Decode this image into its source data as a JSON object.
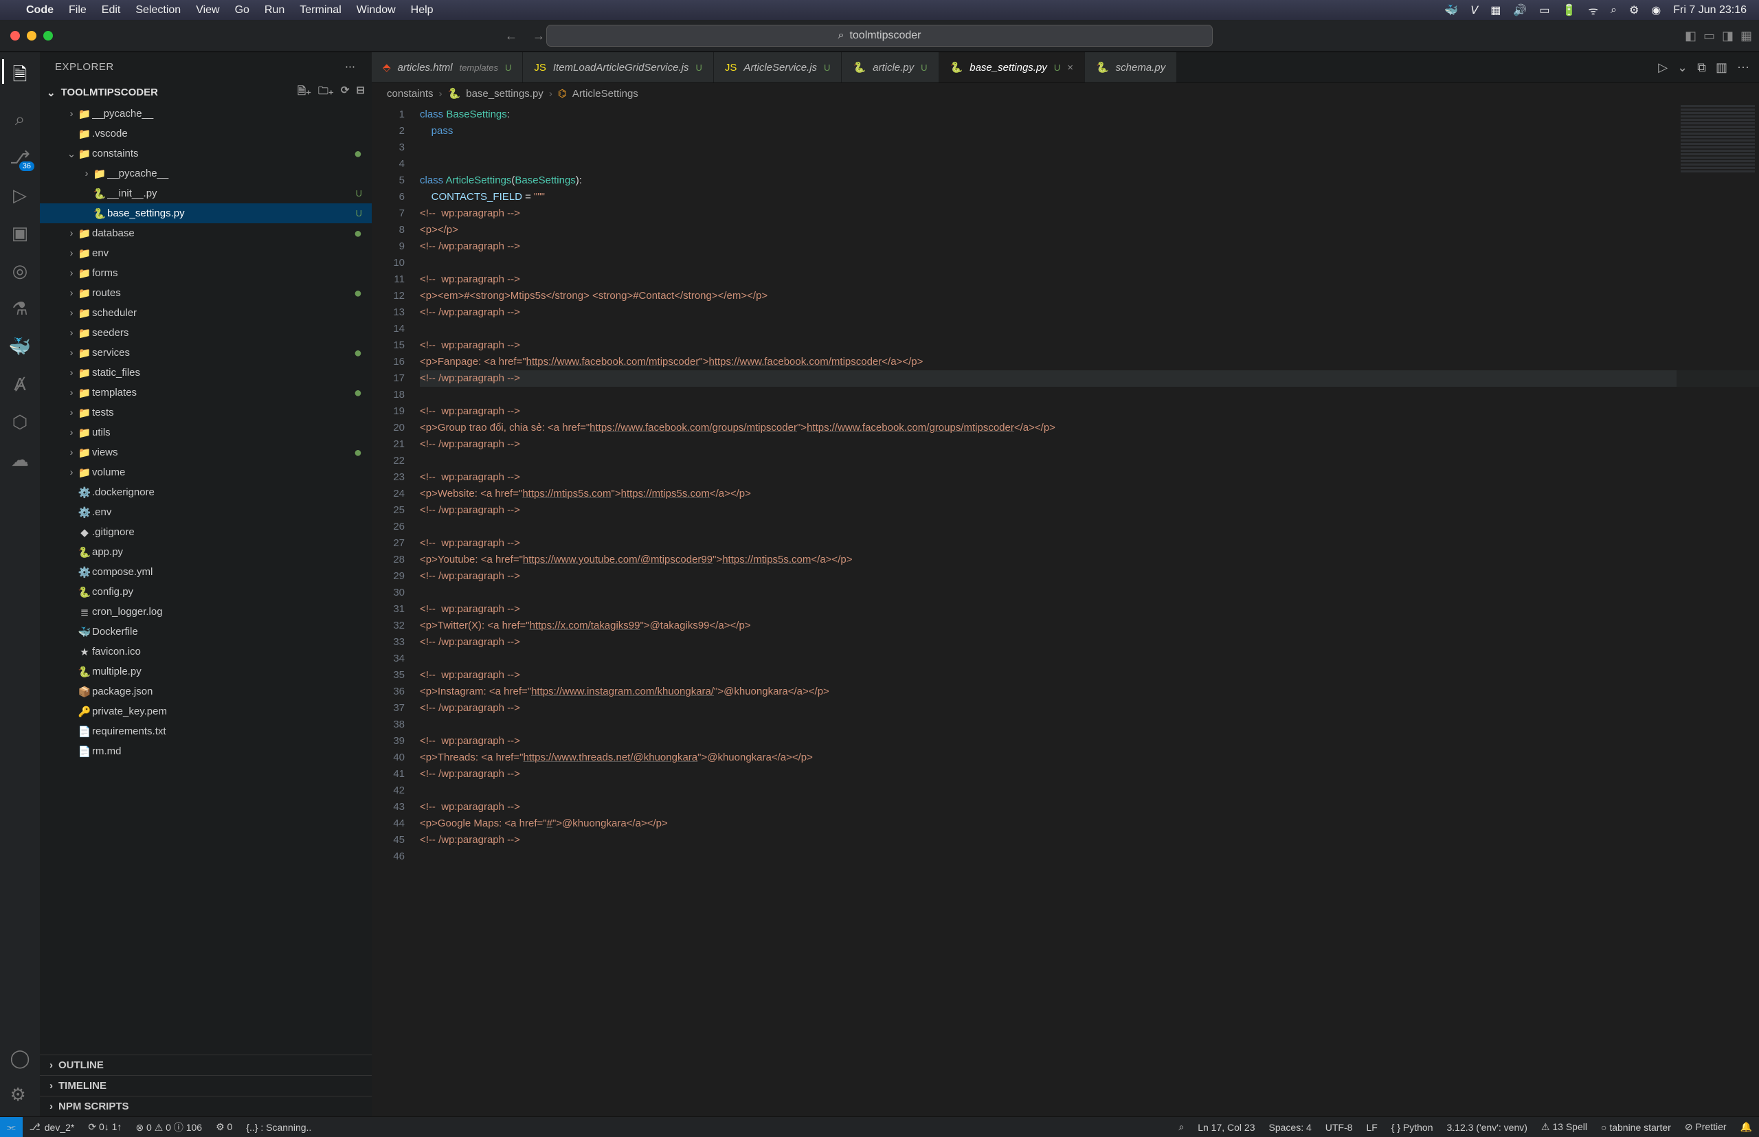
{
  "macos": {
    "app": "Code",
    "menus": [
      "File",
      "Edit",
      "Selection",
      "View",
      "Go",
      "Run",
      "Terminal",
      "Window",
      "Help"
    ],
    "clock": "Fri 7 Jun  23:16"
  },
  "window": {
    "search_placeholder": "toolmtipscoder"
  },
  "explorer": {
    "title": "EXPLORER",
    "root": "TOOLMTIPSCODER",
    "sections": {
      "outline": "OUTLINE",
      "timeline": "TIMELINE",
      "npm": "NPM SCRIPTS"
    }
  },
  "tree": [
    {
      "d": 1,
      "c": ">",
      "i": "📁",
      "n": "__pycache__",
      "cls": "folder",
      "badge": ""
    },
    {
      "d": 1,
      "c": "",
      "i": "📁",
      "n": ".vscode",
      "cls": "folder"
    },
    {
      "d": 1,
      "c": "v",
      "i": "📁",
      "n": "constaints",
      "cls": "folder",
      "dot": true
    },
    {
      "d": 2,
      "c": ">",
      "i": "📁",
      "n": "__pycache__",
      "cls": "folder"
    },
    {
      "d": 2,
      "c": "",
      "i": "🐍",
      "n": "__init__.py",
      "st": "U"
    },
    {
      "d": 2,
      "c": "",
      "i": "🐍",
      "n": "base_settings.py",
      "st": "U",
      "sel": true
    },
    {
      "d": 1,
      "c": ">",
      "i": "📁",
      "n": "database",
      "cls": "folder",
      "dot": true
    },
    {
      "d": 1,
      "c": ">",
      "i": "📁",
      "n": "env",
      "cls": "folder"
    },
    {
      "d": 1,
      "c": ">",
      "i": "📁",
      "n": "forms",
      "cls": "folder"
    },
    {
      "d": 1,
      "c": ">",
      "i": "📁",
      "n": "routes",
      "cls": "folder",
      "dot": true
    },
    {
      "d": 1,
      "c": ">",
      "i": "📁",
      "n": "scheduler",
      "cls": "folder"
    },
    {
      "d": 1,
      "c": ">",
      "i": "📁",
      "n": "seeders",
      "cls": "folder"
    },
    {
      "d": 1,
      "c": ">",
      "i": "📁",
      "n": "services",
      "cls": "folder",
      "dot": true
    },
    {
      "d": 1,
      "c": ">",
      "i": "📁",
      "n": "static_files",
      "cls": "folder"
    },
    {
      "d": 1,
      "c": ">",
      "i": "📁",
      "n": "templates",
      "cls": "folder",
      "dot": true
    },
    {
      "d": 1,
      "c": ">",
      "i": "📁",
      "n": "tests",
      "cls": "folder"
    },
    {
      "d": 1,
      "c": ">",
      "i": "📁",
      "n": "utils",
      "cls": "folder"
    },
    {
      "d": 1,
      "c": ">",
      "i": "📁",
      "n": "views",
      "cls": "folder",
      "dot": true
    },
    {
      "d": 1,
      "c": ">",
      "i": "📁",
      "n": "volume",
      "cls": "folder"
    },
    {
      "d": 1,
      "c": "",
      "i": "⚙️",
      "n": ".dockerignore"
    },
    {
      "d": 1,
      "c": "",
      "i": "⚙️",
      "n": ".env"
    },
    {
      "d": 1,
      "c": "",
      "i": "◆",
      "n": ".gitignore"
    },
    {
      "d": 1,
      "c": "",
      "i": "🐍",
      "n": "app.py"
    },
    {
      "d": 1,
      "c": "",
      "i": "⚙️",
      "n": "compose.yml"
    },
    {
      "d": 1,
      "c": "",
      "i": "🐍",
      "n": "config.py"
    },
    {
      "d": 1,
      "c": "",
      "i": "≣",
      "n": "cron_logger.log"
    },
    {
      "d": 1,
      "c": "",
      "i": "🐳",
      "n": "Dockerfile"
    },
    {
      "d": 1,
      "c": "",
      "i": "★",
      "n": "favicon.ico"
    },
    {
      "d": 1,
      "c": "",
      "i": "🐍",
      "n": "multiple.py"
    },
    {
      "d": 1,
      "c": "",
      "i": "📦",
      "n": "package.json"
    },
    {
      "d": 1,
      "c": "",
      "i": "🔑",
      "n": "private_key.pem"
    },
    {
      "d": 1,
      "c": "",
      "i": "📄",
      "n": "requirements.txt"
    },
    {
      "d": 1,
      "c": "",
      "i": "📄",
      "n": "rm.md"
    }
  ],
  "tabs": [
    {
      "i": "⬘",
      "fi": "#e44d26",
      "n": "articles.html",
      "sub": "templates",
      "st": "U"
    },
    {
      "i": "JS",
      "fi": "#f7df1e",
      "n": "ItemLoadArticleGridService.js",
      "st": "U"
    },
    {
      "i": "JS",
      "fi": "#f7df1e",
      "n": "ArticleService.js",
      "st": "U"
    },
    {
      "i": "🐍",
      "fi": "#4b8bbe",
      "n": "article.py",
      "st": "U"
    },
    {
      "i": "🐍",
      "fi": "#4b8bbe",
      "n": "base_settings.py",
      "st": "U",
      "active": true,
      "close": "×"
    },
    {
      "i": "🐍",
      "fi": "#4b8bbe",
      "n": "schema.py",
      "st": ""
    }
  ],
  "crumbs": [
    "constaints",
    "base_settings.py",
    "ArticleSettings"
  ],
  "code": [
    {
      "n": 1,
      "t": "class",
      "html": "<span class='k'>class</span> <span class='cls'>BaseSettings</span>:"
    },
    {
      "n": 2,
      "html": "    <span class='k'>pass</span>"
    },
    {
      "n": 3,
      "html": ""
    },
    {
      "n": 4,
      "html": ""
    },
    {
      "n": 5,
      "html": "<span class='k'>class</span> <span class='cls'>ArticleSettings</span>(<span class='cls'>BaseSettings</span>):"
    },
    {
      "n": 6,
      "html": "    <span class='v'>CONTACTS_FIELD</span> = <span class='s'>\"\"\"</span>"
    },
    {
      "n": 7,
      "html": "<span class='s'>&lt;!--  wp:paragraph --&gt;</span>"
    },
    {
      "n": 8,
      "html": "<span class='s'>&lt;p&gt;&lt;/p&gt;</span>"
    },
    {
      "n": 9,
      "html": "<span class='s'>&lt;!-- /wp:paragraph --&gt;</span>"
    },
    {
      "n": 10,
      "html": ""
    },
    {
      "n": 11,
      "html": "<span class='s'>&lt;!--  wp:paragraph --&gt;</span>"
    },
    {
      "n": 12,
      "html": "<span class='s'>&lt;p&gt;&lt;em&gt;#&lt;strong&gt;Mtips5s&lt;/strong&gt; &lt;strong&gt;#Contact&lt;/strong&gt;&lt;/em&gt;&lt;/p&gt;</span>"
    },
    {
      "n": 13,
      "html": "<span class='s'>&lt;!-- /wp:paragraph --&gt;</span>"
    },
    {
      "n": 14,
      "html": ""
    },
    {
      "n": 15,
      "html": "<span class='s'>&lt;!--  wp:paragraph --&gt;</span>"
    },
    {
      "n": 16,
      "html": "<span class='s'>&lt;p&gt;Fanpage: &lt;a href=\"</span><span class='lnk'>https://www.facebook.com/mtipscoder</span><span class='s'>\"&gt;</span><span class='lnk'>https://www.facebook.com/mtipscoder</span><span class='s'>&lt;/a&gt;&lt;/p&gt;</span>"
    },
    {
      "n": 17,
      "hl": true,
      "html": "<span class='s'>&lt;!-- /wp:paragraph --&gt;</span>"
    },
    {
      "n": 18,
      "html": ""
    },
    {
      "n": 19,
      "html": "<span class='s'>&lt;!--  wp:paragraph --&gt;</span>"
    },
    {
      "n": 20,
      "html": "<span class='s'>&lt;p&gt;Group trao đổi, chia sẻ: &lt;a href=\"</span><span class='lnk'>https://www.facebook.com/groups/mtipscoder</span><span class='s'>\"&gt;</span><span class='lnk'>https://www.facebook.com/groups/mtipscoder</span><span class='s'>&lt;/a&gt;&lt;/p&gt;</span>"
    },
    {
      "n": 21,
      "html": "<span class='s'>&lt;!-- /wp:paragraph --&gt;</span>"
    },
    {
      "n": 22,
      "html": ""
    },
    {
      "n": 23,
      "html": "<span class='s'>&lt;!--  wp:paragraph --&gt;</span>"
    },
    {
      "n": 24,
      "html": "<span class='s'>&lt;p&gt;Website: &lt;a href=\"</span><span class='lnk'>https://mtips5s.com</span><span class='s'>\"&gt;</span><span class='lnk'>https://mtips5s.com</span><span class='s'>&lt;/a&gt;&lt;/p&gt;</span>"
    },
    {
      "n": 25,
      "html": "<span class='s'>&lt;!-- /wp:paragraph --&gt;</span>"
    },
    {
      "n": 26,
      "html": ""
    },
    {
      "n": 27,
      "html": "<span class='s'>&lt;!--  wp:paragraph --&gt;</span>"
    },
    {
      "n": 28,
      "html": "<span class='s'>&lt;p&gt;Youtube: &lt;a href=\"</span><span class='lnk'>https://www.youtube.com/@mtipscoder99</span><span class='s'>\"&gt;</span><span class='lnk'>https://mtips5s.com</span><span class='s'>&lt;/a&gt;&lt;/p&gt;</span>"
    },
    {
      "n": 29,
      "html": "<span class='s'>&lt;!-- /wp:paragraph --&gt;</span>"
    },
    {
      "n": 30,
      "html": ""
    },
    {
      "n": 31,
      "html": "<span class='s'>&lt;!--  wp:paragraph --&gt;</span>"
    },
    {
      "n": 32,
      "html": "<span class='s'>&lt;p&gt;Twitter(X): &lt;a href=\"</span><span class='lnk'>https://x.com/takagiks99</span><span class='s'>\"&gt;@takagiks99&lt;/a&gt;&lt;/p&gt;</span>"
    },
    {
      "n": 33,
      "html": "<span class='s'>&lt;!-- /wp:paragraph --&gt;</span>"
    },
    {
      "n": 34,
      "html": ""
    },
    {
      "n": 35,
      "html": "<span class='s'>&lt;!--  wp:paragraph --&gt;</span>"
    },
    {
      "n": 36,
      "html": "<span class='s'>&lt;p&gt;Instagram: &lt;a href=\"</span><span class='lnk'>https://www.instagram.com/khuongkara/</span><span class='s'>\"&gt;@khuongkara&lt;/a&gt;&lt;/p&gt;</span>"
    },
    {
      "n": 37,
      "html": "<span class='s'>&lt;!-- /wp:paragraph --&gt;</span>"
    },
    {
      "n": 38,
      "html": ""
    },
    {
      "n": 39,
      "html": "<span class='s'>&lt;!--  wp:paragraph --&gt;</span>"
    },
    {
      "n": 40,
      "html": "<span class='s'>&lt;p&gt;Threads: &lt;a href=\"</span><span class='lnk'>https://www.threads.net/@khuongkara</span><span class='s'>\"&gt;@khuongkara&lt;/a&gt;&lt;/p&gt;</span>"
    },
    {
      "n": 41,
      "html": "<span class='s'>&lt;!-- /wp:paragraph --&gt;</span>"
    },
    {
      "n": 42,
      "html": ""
    },
    {
      "n": 43,
      "html": "<span class='s'>&lt;!--  wp:paragraph --&gt;</span>"
    },
    {
      "n": 44,
      "html": "<span class='s'>&lt;p&gt;Google Maps: &lt;a href=\"</span><span class='lnk'>#</span><span class='s'>\"&gt;@khuongkara&lt;/a&gt;&lt;/p&gt;</span>"
    },
    {
      "n": 45,
      "html": "<span class='s'>&lt;!-- /wp:paragraph --&gt;</span>"
    },
    {
      "n": 46,
      "html": ""
    }
  ],
  "status": {
    "branch": "dev_2*",
    "sync": "⟳ 0↓ 1↑",
    "errors": "⊗ 0 ⚠ 0 ⓘ 106",
    "ports": "⚙ 0",
    "scan": "{..} : Scanning..",
    "search_icon": "⌕",
    "pos": "Ln 17, Col 23",
    "spaces": "Spaces: 4",
    "enc": "UTF-8",
    "eol": "LF",
    "lang": "{ } Python",
    "py": "3.12.3 ('env': venv)",
    "spell": "⚠ 13 Spell",
    "tabnine": "○ tabnine starter",
    "prettier": "⊘ Prettier",
    "bell": "🔔"
  },
  "activity_badge": "36"
}
